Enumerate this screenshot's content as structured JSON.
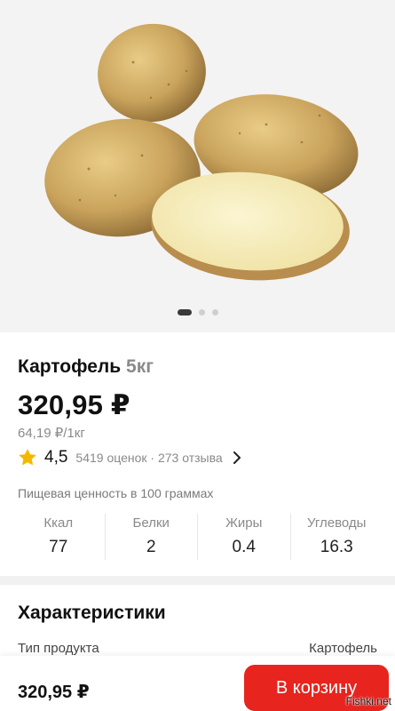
{
  "product": {
    "name": "Картофель",
    "weight": "5кг",
    "price": "320,95 ₽",
    "unit_price": "64,19 ₽/1кг",
    "rating": "4,5",
    "rating_meta": "5419 оценок · 273 отзыва"
  },
  "gallery": {
    "total_images": 3,
    "active_index": 0
  },
  "nutrition": {
    "title": "Пищевая ценность в 100 граммах",
    "items": [
      {
        "label": "Ккал",
        "value": "77"
      },
      {
        "label": "Белки",
        "value": "2"
      },
      {
        "label": "Жиры",
        "value": "0.4"
      },
      {
        "label": "Углеводы",
        "value": "16.3"
      }
    ]
  },
  "specs": {
    "title": "Характеристики",
    "rows": [
      {
        "key": "Тип продукта",
        "value": "Картофель"
      }
    ]
  },
  "bottom_bar": {
    "price": "320,95 ₽",
    "cart_label": "В корзину"
  },
  "watermark": "Fishki.net",
  "colors": {
    "accent": "#e8241e",
    "star": "#f5b800",
    "muted": "#8a8a8a"
  }
}
